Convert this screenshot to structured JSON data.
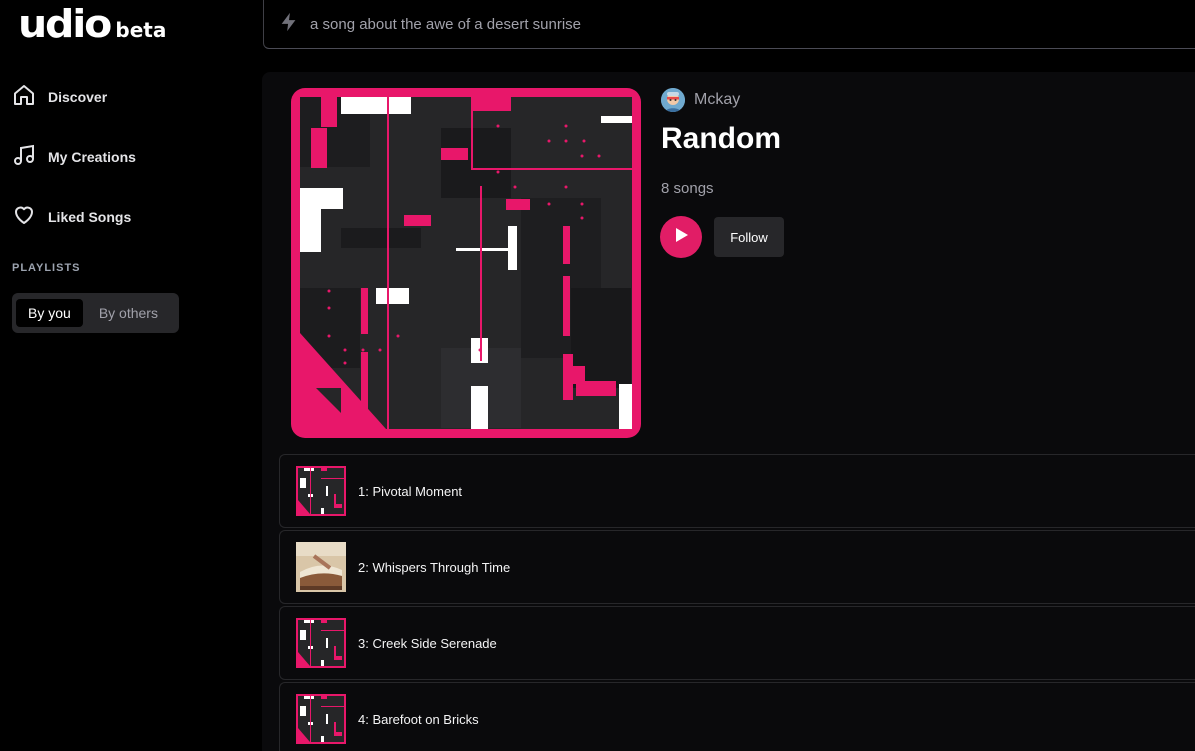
{
  "app": {
    "logo_word": "udio",
    "logo_tag": "beta"
  },
  "sidebar": {
    "items": [
      {
        "label": "Discover",
        "icon": "home-icon"
      },
      {
        "label": "My Creations",
        "icon": "music-note-icon"
      },
      {
        "label": "Liked Songs",
        "icon": "heart-icon"
      }
    ],
    "section_label": "PLAYLISTS",
    "segment": {
      "active": "By you",
      "inactive": "By others"
    }
  },
  "search": {
    "placeholder": "a song about the awe of a desert sunrise",
    "icon": "lightning-icon"
  },
  "playlist": {
    "creator": "Mckay",
    "title": "Random",
    "song_count": "8 songs",
    "follow_label": "Follow",
    "play_icon": "play-icon"
  },
  "tracks": [
    {
      "title": "1: Pivotal Moment",
      "art": "pink-pixel"
    },
    {
      "title": "2: Whispers Through Time",
      "art": "book-photo"
    },
    {
      "title": "3: Creek Side Serenade",
      "art": "pink-pixel"
    },
    {
      "title": "4: Barefoot on Bricks",
      "art": "pink-pixel"
    }
  ],
  "colors": {
    "accent": "#e11d66",
    "background": "#000000",
    "panel": "#0a0a0c",
    "muted_text": "#a1a1aa"
  }
}
